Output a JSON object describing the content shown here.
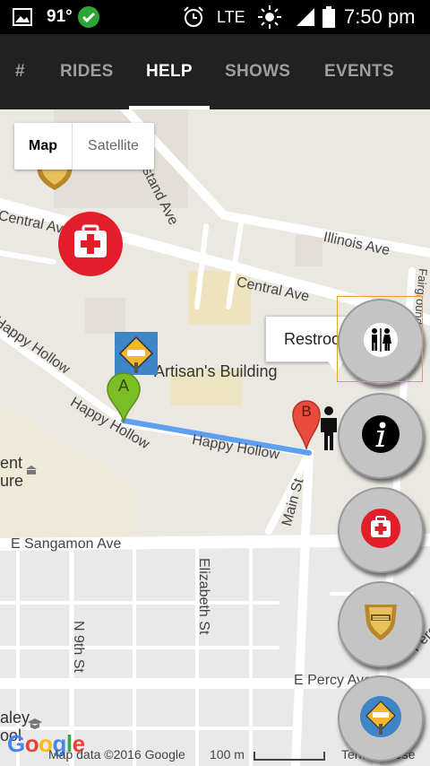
{
  "status_bar": {
    "temperature": "91°",
    "network": "LTE",
    "time": "7:50 pm"
  },
  "tabs": [
    {
      "label": "#"
    },
    {
      "label": "RIDES"
    },
    {
      "label": "HELP"
    },
    {
      "label": "SHOWS"
    },
    {
      "label": "EVENTS"
    }
  ],
  "active_tab": "HELP",
  "map": {
    "type_toggle": {
      "map_label": "Map",
      "satellite_label": "Satellite",
      "selected": "Map"
    },
    "street_labels": {
      "grandstand": "Grandstand Ave",
      "central_left": "Central Ave",
      "central": "Central Ave",
      "illinois": "Illinois Ave",
      "happy_hollow_left": "Happy Hollow",
      "happy_hollow_1": "Happy Hollow",
      "happy_hollow_2": "Happy Hollow",
      "main": "Main St",
      "sangamon": "E Sangamon Ave",
      "sangamon_right": "E Sangamon Ave",
      "n9th": "N 9th St",
      "elizabeth": "Elizabeth St",
      "percy": "E Percy Ave",
      "percy_right": "Percy",
      "fairground": "Fairground Ln",
      "left_ent": "ent",
      "left_ure": "ure",
      "left_aley": "aley",
      "left_ool": "ool"
    },
    "place_label": "Artisan's Building",
    "callout_text": "Restroom",
    "marker_a": "A",
    "marker_b": "B",
    "attribution": "Map data ©2016 Google",
    "scale_label": "100 m",
    "terms": "Terms of Use",
    "logo": "Google"
  },
  "fab_buttons": [
    {
      "icon": "restroom-icon"
    },
    {
      "icon": "info-icon"
    },
    {
      "icon": "first-aid-icon"
    },
    {
      "icon": "police-badge-icon"
    },
    {
      "icon": "directions-sign-icon"
    }
  ],
  "colors": {
    "tab_bar": "#212121",
    "first_aid_red": "#e31e2a",
    "route_blue": "#5e9ff2",
    "marker_green": "#7cbd25",
    "marker_red": "#e94c3d"
  }
}
